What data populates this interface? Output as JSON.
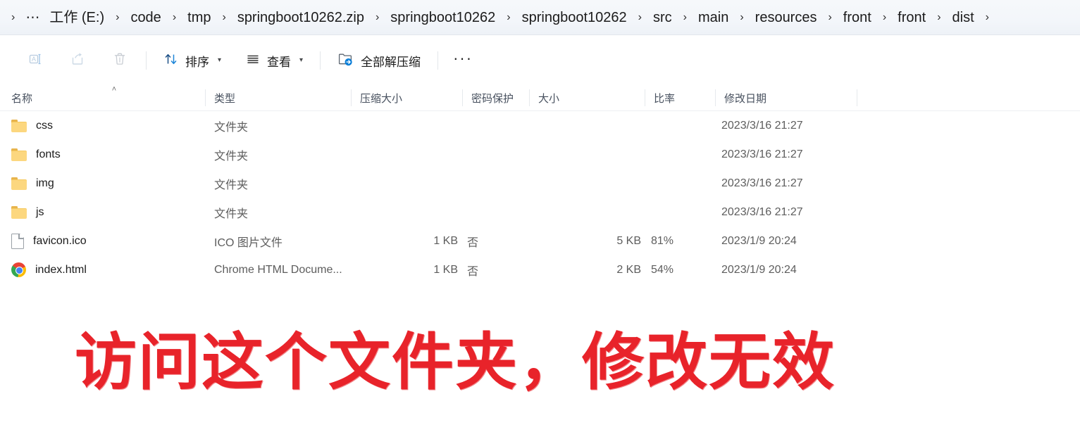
{
  "address_bar": {
    "overflow_icon": "ellipsis-overflow",
    "separator": "›",
    "crumbs": [
      {
        "label": "工作 (E:)"
      },
      {
        "label": "code"
      },
      {
        "label": "tmp"
      },
      {
        "label": "springboot10262.zip"
      },
      {
        "label": "springboot10262"
      },
      {
        "label": "springboot10262"
      },
      {
        "label": "src"
      },
      {
        "label": "main"
      },
      {
        "label": "resources"
      },
      {
        "label": "front"
      },
      {
        "label": "front"
      },
      {
        "label": "dist"
      }
    ]
  },
  "toolbar": {
    "rename_label": "重命名",
    "share_label": "共享",
    "delete_label": "删除",
    "sort_label": "排序",
    "view_label": "查看",
    "extract_all_label": "全部解压缩",
    "more_label": "···",
    "chevron": "⌄"
  },
  "columns": {
    "name": "名称",
    "type": "类型",
    "packed_size": "压缩大小",
    "password_protected": "密码保护",
    "size": "大小",
    "ratio": "比率",
    "date_modified": "修改日期",
    "sort_indicator": "˄"
  },
  "files": [
    {
      "icon": "folder-icon",
      "name": "css",
      "type": "文件夹",
      "packed_size": "",
      "password": "",
      "size": "",
      "ratio": "",
      "date": "2023/3/16 21:27"
    },
    {
      "icon": "folder-icon",
      "name": "fonts",
      "type": "文件夹",
      "packed_size": "",
      "password": "",
      "size": "",
      "ratio": "",
      "date": "2023/3/16 21:27"
    },
    {
      "icon": "folder-icon",
      "name": "img",
      "type": "文件夹",
      "packed_size": "",
      "password": "",
      "size": "",
      "ratio": "",
      "date": "2023/3/16 21:27"
    },
    {
      "icon": "folder-icon",
      "name": "js",
      "type": "文件夹",
      "packed_size": "",
      "password": "",
      "size": "",
      "ratio": "",
      "date": "2023/3/16 21:27"
    },
    {
      "icon": "file-icon",
      "name": "favicon.ico",
      "type": "ICO 图片文件",
      "packed_size": "1 KB",
      "password": "否",
      "size": "5 KB",
      "ratio": "81%",
      "date": "2023/1/9 20:24"
    },
    {
      "icon": "chrome-icon",
      "name": "index.html",
      "type": "Chrome HTML Docume...",
      "packed_size": "1 KB",
      "password": "否",
      "size": "2 KB",
      "ratio": "54%",
      "date": "2023/1/9 20:24"
    }
  ],
  "annotation": {
    "text": "访问这个文件夹，修改无效",
    "color": "#e8232a"
  }
}
